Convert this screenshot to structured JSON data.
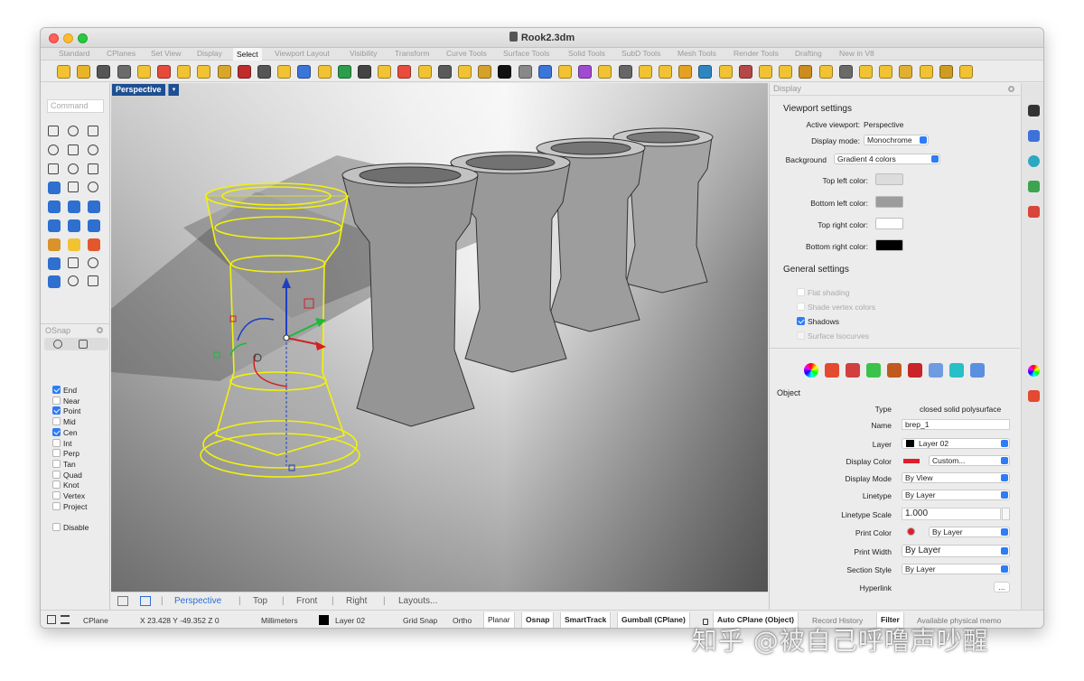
{
  "window": {
    "title": "Rook2.3dm"
  },
  "tabs": [
    "Standard",
    "CPlanes",
    "Set View",
    "Display",
    "Select",
    "Viewport Layout",
    "Visibility",
    "Transform",
    "Curve Tools",
    "Surface Tools",
    "Solid Tools",
    "SubD Tools",
    "Mesh Tools",
    "Render Tools",
    "Drafting",
    "New in V8"
  ],
  "active_tab": "Select",
  "command_placeholder": "Command",
  "viewport": {
    "label": "Perspective",
    "dropdown": "▾"
  },
  "viewport_tabs": [
    "Perspective",
    "Top",
    "Front",
    "Right",
    "Layouts..."
  ],
  "osnap": {
    "title": "OSnap",
    "items": [
      {
        "label": "End",
        "checked": true
      },
      {
        "label": "Near",
        "checked": false
      },
      {
        "label": "Point",
        "checked": true
      },
      {
        "label": "Mid",
        "checked": false
      },
      {
        "label": "Cen",
        "checked": true
      },
      {
        "label": "Int",
        "checked": false
      },
      {
        "label": "Perp",
        "checked": false
      },
      {
        "label": "Tan",
        "checked": false
      },
      {
        "label": "Quad",
        "checked": false
      },
      {
        "label": "Knot",
        "checked": false
      },
      {
        "label": "Vertex",
        "checked": false
      },
      {
        "label": "Project",
        "checked": false
      }
    ],
    "disable": "Disable"
  },
  "display_panel": {
    "title": "Display",
    "viewport_settings": "Viewport settings",
    "active_viewport_label": "Active viewport:",
    "active_viewport_value": "Perspective",
    "display_mode_label": "Display mode:",
    "display_mode_value": "Monochrome",
    "background_label": "Background",
    "background_value": "Gradient 4 colors",
    "top_left_label": "Top left color:",
    "bottom_left_label": "Bottom left color:",
    "top_right_label": "Top right color:",
    "bottom_right_label": "Bottom right color:",
    "colors": {
      "top_left": "#dcdcdc",
      "bottom_left": "#9c9c9c",
      "top_right": "#ffffff",
      "bottom_right": "#000000"
    },
    "general_settings": "General settings",
    "flat_shading": "Flat shading",
    "shade_vertex_colors": "Shade vertex colors",
    "shadows": "Shadows",
    "surface_isocurves": "Surface Isocurves"
  },
  "properties": {
    "section": "Object",
    "type_label": "Type",
    "type_value": "closed solid polysurface",
    "name_label": "Name",
    "name_value": "brep_1",
    "layer_label": "Layer",
    "layer_value": "Layer 02",
    "display_color_label": "Display Color",
    "display_color_value": "Custom...",
    "display_mode_label": "Display Mode",
    "display_mode_value": "By View",
    "linetype_label": "Linetype",
    "linetype_value": "By Layer",
    "linetype_scale_label": "Linetype Scale",
    "linetype_scale_value": "1.000",
    "print_color_label": "Print Color",
    "print_color_value": "By Layer",
    "print_width_label": "Print Width",
    "print_width_value": "By Layer",
    "section_style_label": "Section Style",
    "section_style_value": "By Layer",
    "hyperlink_label": "Hyperlink",
    "hyperlink_value": "...",
    "display_color_swatch": "#e11d2a"
  },
  "status": {
    "cplane": "CPlane",
    "coords": "X 23.428 Y -49.352 Z 0",
    "units": "Millimeters",
    "layer": "Layer 02",
    "grid_snap": "Grid Snap",
    "ortho": "Ortho",
    "planar": "Planar",
    "osnap": "Osnap",
    "smarttrack": "SmartTrack",
    "gumball": "Gumball (CPlane)",
    "auto_cplane": "Auto CPlane (Object)",
    "record_history": "Record History",
    "filter": "Filter",
    "memory": "Available physical memo"
  },
  "watermark": "知乎 @被自己呼噜声吵醒"
}
